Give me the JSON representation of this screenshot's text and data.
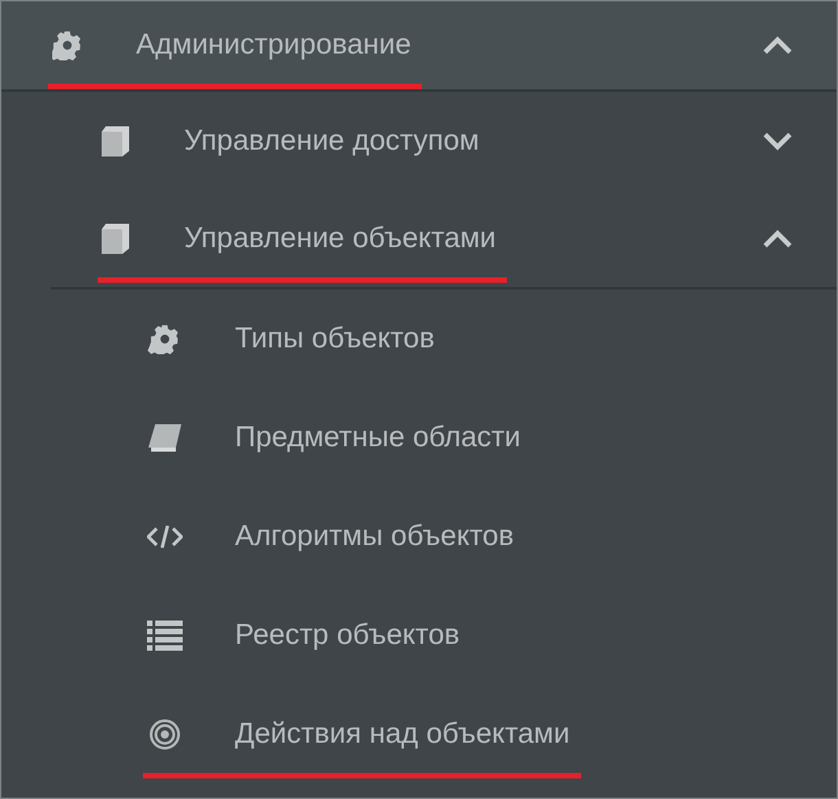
{
  "menu": [
    {
      "label": "Администрирование",
      "expanded": true,
      "underlined": true,
      "children": [
        {
          "label": "Управление доступом",
          "expanded": false,
          "underlined": false
        },
        {
          "label": "Управление объектами",
          "expanded": true,
          "underlined": true,
          "children": [
            {
              "label": "Типы объектов",
              "underlined": false
            },
            {
              "label": "Предметные области",
              "underlined": false
            },
            {
              "label": "Алгоритмы объектов",
              "underlined": false
            },
            {
              "label": "Реестр объектов",
              "underlined": false
            },
            {
              "label": "Действия над объектами",
              "underlined": true
            }
          ]
        }
      ]
    }
  ]
}
